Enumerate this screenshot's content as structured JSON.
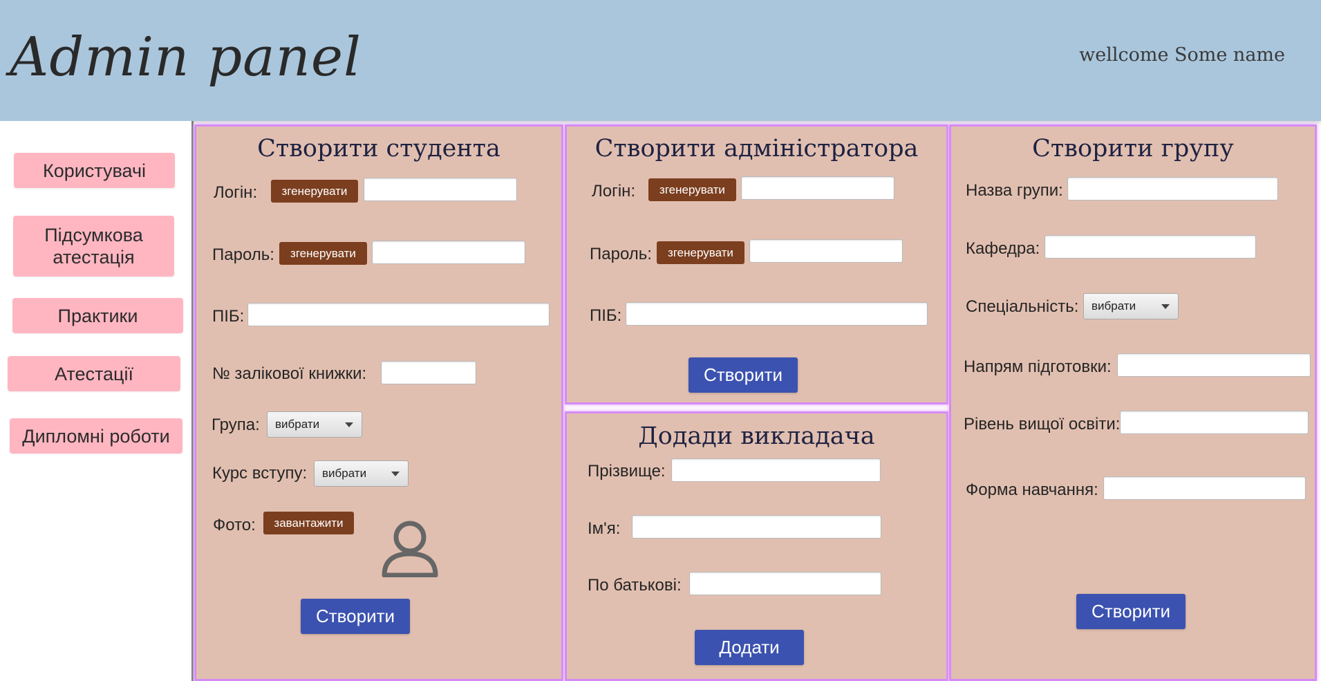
{
  "header": {
    "title": "Admin panel",
    "welcome": "wellcome Some name"
  },
  "sidebar": {
    "items": [
      {
        "label": "Користувачі"
      },
      {
        "label": "Підсумкова атестація"
      },
      {
        "label": "Практики"
      },
      {
        "label": "Атестації"
      },
      {
        "label": "Дипломні роботи"
      }
    ]
  },
  "student_form": {
    "title": "Створити студента",
    "login_label": "Логін:",
    "login_generate": "згенерувати",
    "login_value": "",
    "password_label": "Пароль:",
    "password_generate": "згенерувати",
    "password_value": "",
    "fullname_label": "ПІБ:",
    "fullname_value": "",
    "record_book_label": "№ залікової книжки:",
    "record_book_value": "",
    "group_label": "Група:",
    "group_selected": "вибрати",
    "course_label": "Курс вступу:",
    "course_selected": "вибрати",
    "photo_label": "Фото:",
    "photo_upload": "завантажити",
    "submit": "Створити"
  },
  "admin_form": {
    "title": "Створити адміністратора",
    "login_label": "Логін:",
    "login_generate": "згенерувати",
    "login_value": "",
    "password_label": "Пароль:",
    "password_generate": "згенерувати",
    "password_value": "",
    "fullname_label": "ПІБ:",
    "fullname_value": "",
    "submit": "Створити"
  },
  "teacher_form": {
    "title": "Додади викладача",
    "surname_label": "Прізвище:",
    "surname_value": "",
    "name_label": "Ім'я:",
    "name_value": "",
    "patronymic_label": "По батькові:",
    "patronymic_value": "",
    "submit": "Додати"
  },
  "group_form": {
    "title": "Створити групу",
    "group_name_label": "Назва групи:",
    "group_name_value": "",
    "department_label": "Кафедра:",
    "department_value": "",
    "specialty_label": "Спеціальність:",
    "specialty_selected": "вибрати",
    "direction_label": "Напрям підготовки:",
    "direction_value": "",
    "level_label": "Рівень вищої освіти:",
    "level_value": "",
    "study_form_label": "Форма навчання:",
    "study_form_value": "",
    "submit": "Створити"
  },
  "colors": {
    "header_bg": "#aac6dc",
    "nav_button": "#ffb6c1",
    "panel_bg": "#e1bfb0",
    "panel_border": "#d58bf5",
    "generate_button": "#7b3e1f",
    "primary_button": "#3c52b0"
  },
  "icons": {
    "photo_placeholder": "user-avatar-icon",
    "dropdown": "chevron-down-icon"
  }
}
